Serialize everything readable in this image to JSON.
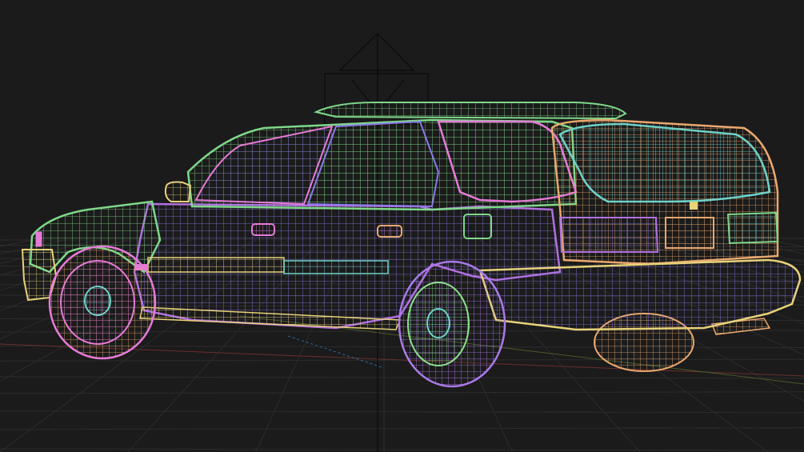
{
  "viewport": {
    "background": "#1b1b1b",
    "grid_color": "#2c2c2c",
    "axis_x_color": "#6b2e2e",
    "axis_y_color": "#4a5a2a",
    "light_gizmo_color": "#0a0a0a"
  },
  "model": {
    "colors": {
      "body_green": "#7fd88a",
      "body_blue": "#8c78e8",
      "body_purple": "#b070e0",
      "body_yellow": "#e8d27a",
      "body_teal": "#6fd2c8",
      "body_pink": "#e67ad7",
      "body_orange": "#e9a86f",
      "wheel_pink": "#e67ad7",
      "wheel_green": "#8ee08a",
      "hub_teal": "#6fd2c8",
      "tire_purple": "#a97ae8"
    }
  }
}
